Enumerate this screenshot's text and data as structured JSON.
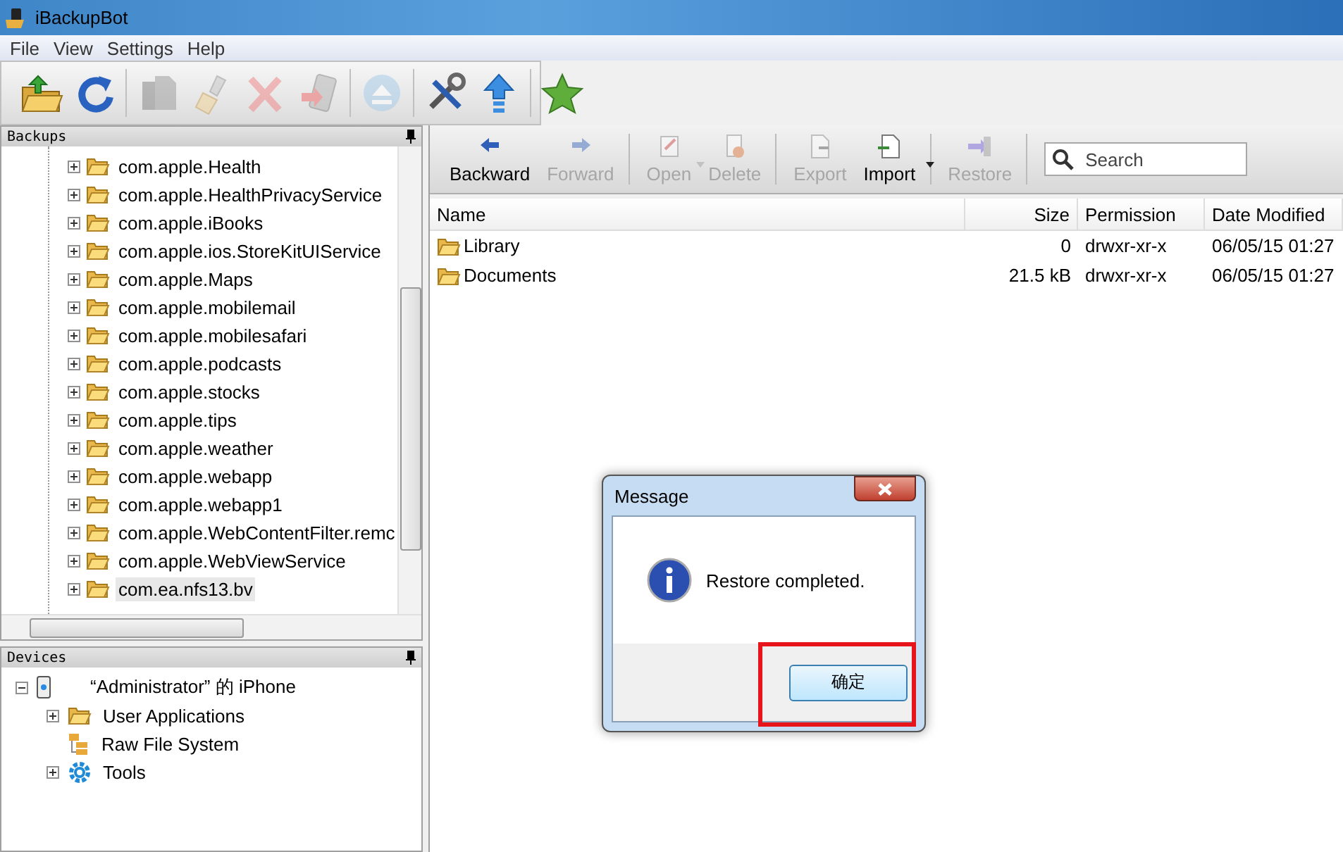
{
  "window": {
    "title": "iBackupBot"
  },
  "menu": [
    "File",
    "View",
    "Settings",
    "Help"
  ],
  "toolbar_groups": [
    {
      "items": [
        {
          "kind": "open",
          "disabled": false
        },
        {
          "kind": "refresh",
          "disabled": false
        }
      ]
    },
    {
      "items": [
        {
          "kind": "copy",
          "disabled": true
        },
        {
          "kind": "brush",
          "disabled": true
        },
        {
          "kind": "delete",
          "disabled": true
        },
        {
          "kind": "phone",
          "disabled": true
        }
      ]
    },
    {
      "items": [
        {
          "kind": "eject",
          "disabled": true
        }
      ]
    },
    {
      "items": [
        {
          "kind": "tools",
          "disabled": false
        },
        {
          "kind": "upload",
          "disabled": false
        }
      ]
    },
    {
      "items": [
        {
          "kind": "star",
          "disabled": false
        }
      ]
    }
  ],
  "backups": {
    "title": "Backups",
    "items": [
      {
        "label": "com.apple.Health",
        "expanded": false,
        "selected": false
      },
      {
        "label": "com.apple.HealthPrivacyService",
        "expanded": false,
        "selected": false
      },
      {
        "label": "com.apple.iBooks",
        "expanded": false,
        "selected": false
      },
      {
        "label": "com.apple.ios.StoreKitUIService",
        "expanded": false,
        "selected": false
      },
      {
        "label": "com.apple.Maps",
        "expanded": false,
        "selected": false
      },
      {
        "label": "com.apple.mobilemail",
        "expanded": false,
        "selected": false
      },
      {
        "label": "com.apple.mobilesafari",
        "expanded": false,
        "selected": false
      },
      {
        "label": "com.apple.podcasts",
        "expanded": false,
        "selected": false
      },
      {
        "label": "com.apple.stocks",
        "expanded": false,
        "selected": false
      },
      {
        "label": "com.apple.tips",
        "expanded": false,
        "selected": false
      },
      {
        "label": "com.apple.weather",
        "expanded": false,
        "selected": false
      },
      {
        "label": "com.apple.webapp",
        "expanded": false,
        "selected": false
      },
      {
        "label": "com.apple.webapp1",
        "expanded": false,
        "selected": false
      },
      {
        "label": "com.apple.WebContentFilter.remc",
        "expanded": false,
        "selected": false
      },
      {
        "label": "com.apple.WebViewService",
        "expanded": false,
        "selected": false
      },
      {
        "label": "com.ea.nfs13.bv",
        "expanded": false,
        "selected": true
      }
    ]
  },
  "devices": {
    "title": "Devices",
    "items": [
      {
        "label": "“Administrator” 的 iPhone",
        "kind": "phone",
        "expanded": true,
        "children": [
          {
            "label": "User Applications",
            "kind": "folder",
            "expandable": true
          },
          {
            "label": "Raw File System",
            "kind": "drawers",
            "expandable": false
          },
          {
            "label": "Tools",
            "kind": "gear",
            "expandable": true
          }
        ]
      }
    ]
  },
  "file_toolbar": {
    "buttons": [
      {
        "label": "Backward",
        "kind": "back",
        "disabled": false,
        "dropdown": false,
        "group_end": false
      },
      {
        "label": "Forward",
        "kind": "forward",
        "disabled": true,
        "dropdown": false,
        "group_end": true
      },
      {
        "label": "Open",
        "kind": "open",
        "disabled": true,
        "dropdown": true,
        "group_end": false
      },
      {
        "label": "Delete",
        "kind": "delete",
        "disabled": true,
        "dropdown": false,
        "group_end": true
      },
      {
        "label": "Export",
        "kind": "export",
        "disabled": true,
        "dropdown": false,
        "group_end": false
      },
      {
        "label": "Import",
        "kind": "import",
        "disabled": false,
        "dropdown": true,
        "group_end": true
      },
      {
        "label": "Restore",
        "kind": "restore",
        "disabled": true,
        "dropdown": false,
        "group_end": true
      }
    ],
    "search": {
      "placeholder": "Search"
    }
  },
  "table": {
    "columns": [
      "Name",
      "Size",
      "Permission",
      "Date Modified"
    ],
    "rows": [
      {
        "name": "Library",
        "size": "0",
        "permission": "drwxr-xr-x",
        "date": "06/05/15 01:27"
      },
      {
        "name": "Documents",
        "size": "21.5 kB",
        "permission": "drwxr-xr-x",
        "date": "06/05/15 01:27"
      }
    ]
  },
  "dialog": {
    "title": "Message",
    "message": "Restore completed.",
    "button": "确定",
    "button_highlighted": true
  }
}
